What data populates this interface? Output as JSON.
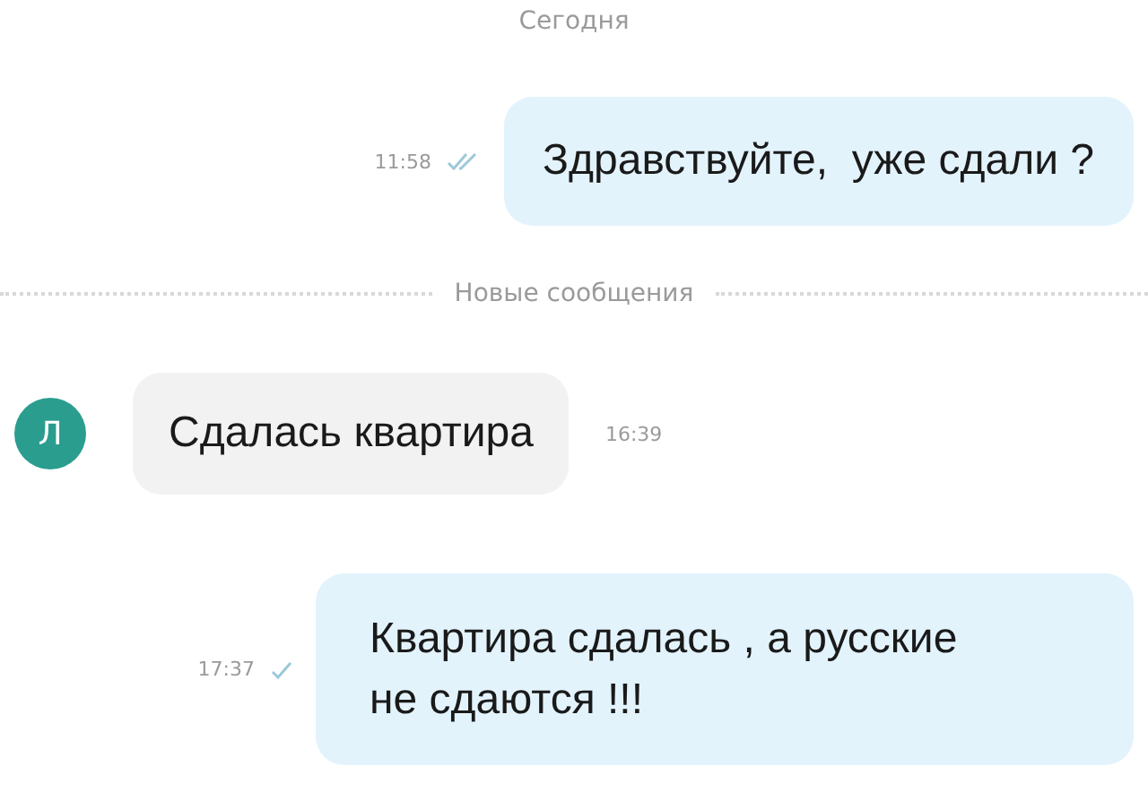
{
  "date_label": "Сегодня",
  "messages": [
    {
      "kind": "outgoing",
      "time": "11:58",
      "read": true,
      "text": "Здравствуйте,  уже сдали ?"
    },
    {
      "kind": "divider",
      "text": "Новые сообщения"
    },
    {
      "kind": "incoming",
      "avatar": "Л",
      "color": "#2a9d8f",
      "time": "16:39",
      "text": "Сдалась квартира"
    },
    {
      "kind": "outgoing",
      "time": "17:37",
      "read": false,
      "text": "Квартира сдалась , а русские не сдаются !!!"
    }
  ]
}
